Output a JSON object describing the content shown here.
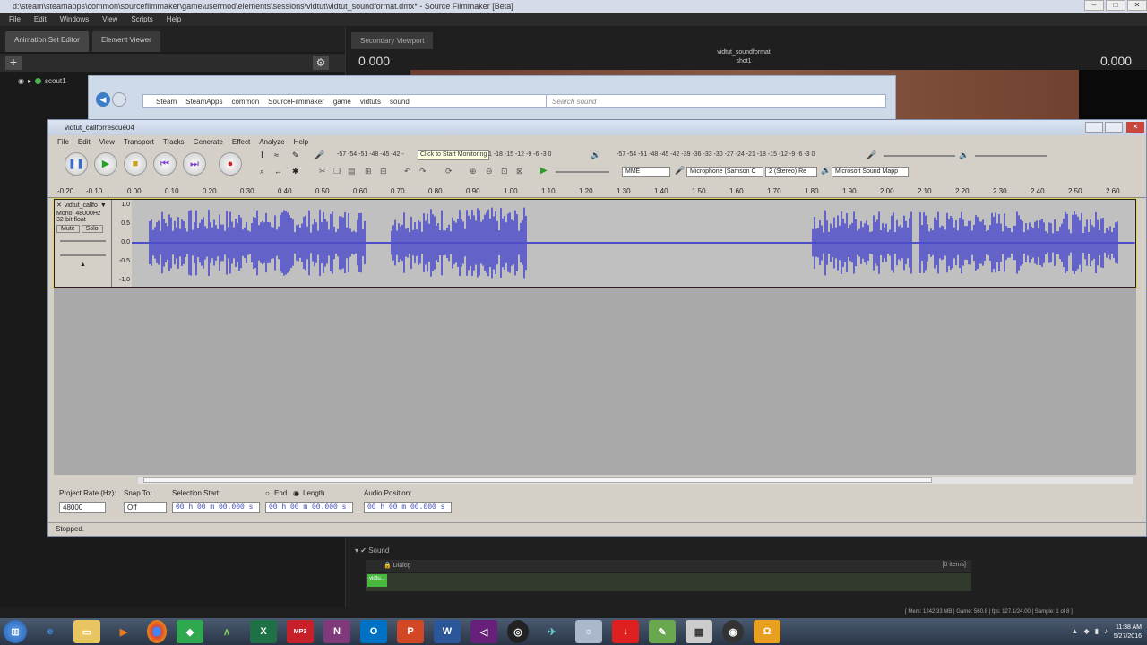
{
  "sfm": {
    "title": "d:\\steam\\steamapps\\common\\sourcefilmmaker\\game\\usermod\\elements\\sessions\\vidtut\\vidtut_soundformat.dmx* - Source Filmmaker [Beta]",
    "menu": [
      "File",
      "Edit",
      "Windows",
      "View",
      "Scripts",
      "Help"
    ],
    "tabs": [
      "Animation Set Editor",
      "Element Viewer"
    ],
    "add_label": "+",
    "tree_item": "scout1",
    "secondary_tab": "Secondary Viewport",
    "viewport_left": "0.000",
    "viewport_right": "0.000",
    "viewport_name": "vidtut_soundformat",
    "viewport_shot": "shot1",
    "timeline_sound": "Sound",
    "timeline_dialog": "Dialog",
    "timeline_count": "[0 items]",
    "timeline_clip": "vidtu...",
    "status": "[ Mem: 1242.33 MB | Game: 560.8 | fps: 127.1/24.00 | Sample: 1 of 8 ]"
  },
  "explorer": {
    "path": [
      "Steam",
      "SteamApps",
      "common",
      "SourceFilmmaker",
      "game",
      "vidtuts",
      "sound"
    ],
    "search_placeholder": "Search sound"
  },
  "audacity": {
    "title": "vidtut_callforrescue04",
    "menu": [
      "File",
      "Edit",
      "View",
      "Transport",
      "Tracks",
      "Generate",
      "Effect",
      "Analyze",
      "Help"
    ],
    "monitor_hint": "Click to Start Monitoring",
    "meter_rec": "-57 -54 -51 -48 -45 -42 -",
    "meter_rec2": "1 -18 -15 -12 -9 -6 -3 0",
    "meter_play": "-57 -54 -51 -48 -45 -42 -39 -36 -33 -30 -27 -24 -21 -18 -15 -12 -9 -6 -3 0",
    "host": "MME",
    "input_device": "Microphone (Samson C",
    "channels": "2 (Stereo) Re",
    "output_device": "Microsoft Sound Mapp",
    "ticks": [
      "-0.20",
      "-0.10",
      "0.00",
      "0.10",
      "0.20",
      "0.30",
      "0.40",
      "0.50",
      "0.60",
      "0.70",
      "0.80",
      "0.90",
      "1.00",
      "1.10",
      "1.20",
      "1.30",
      "1.40",
      "1.50",
      "1.60",
      "1.70",
      "1.80",
      "1.90",
      "2.00",
      "2.10",
      "2.20",
      "2.30",
      "2.40",
      "2.50",
      "2.60"
    ],
    "track": {
      "name": "vidtut_callfo",
      "info1": "Mono, 48000Hz",
      "info2": "32-bit float",
      "mute": "Mute",
      "solo": "Solo",
      "scale": [
        "1.0",
        "0.5",
        "0.0",
        "-0.5",
        "-1.0"
      ]
    },
    "project_rate_label": "Project Rate (Hz):",
    "project_rate": "48000",
    "snap_label": "Snap To:",
    "snap_value": "Off",
    "selection_start_label": "Selection Start:",
    "end_label": "End",
    "length_label": "Length",
    "audio_position_label": "Audio Position:",
    "time_value": "00 h 00 m 00.000 s",
    "status": "Stopped."
  },
  "clock": {
    "time": "11:38 AM",
    "date": "5/27/2016"
  },
  "taskbar": [
    "windows-start",
    "ie",
    "explorer",
    "media",
    "chrome",
    "evernote",
    "android",
    "excel",
    "mp3",
    "onenote",
    "outlook",
    "powerpoint",
    "word",
    "visual-studio",
    "steam-sfm",
    "app",
    "sfm",
    "download",
    "notepad",
    "calculator",
    "camera",
    "headphones"
  ]
}
